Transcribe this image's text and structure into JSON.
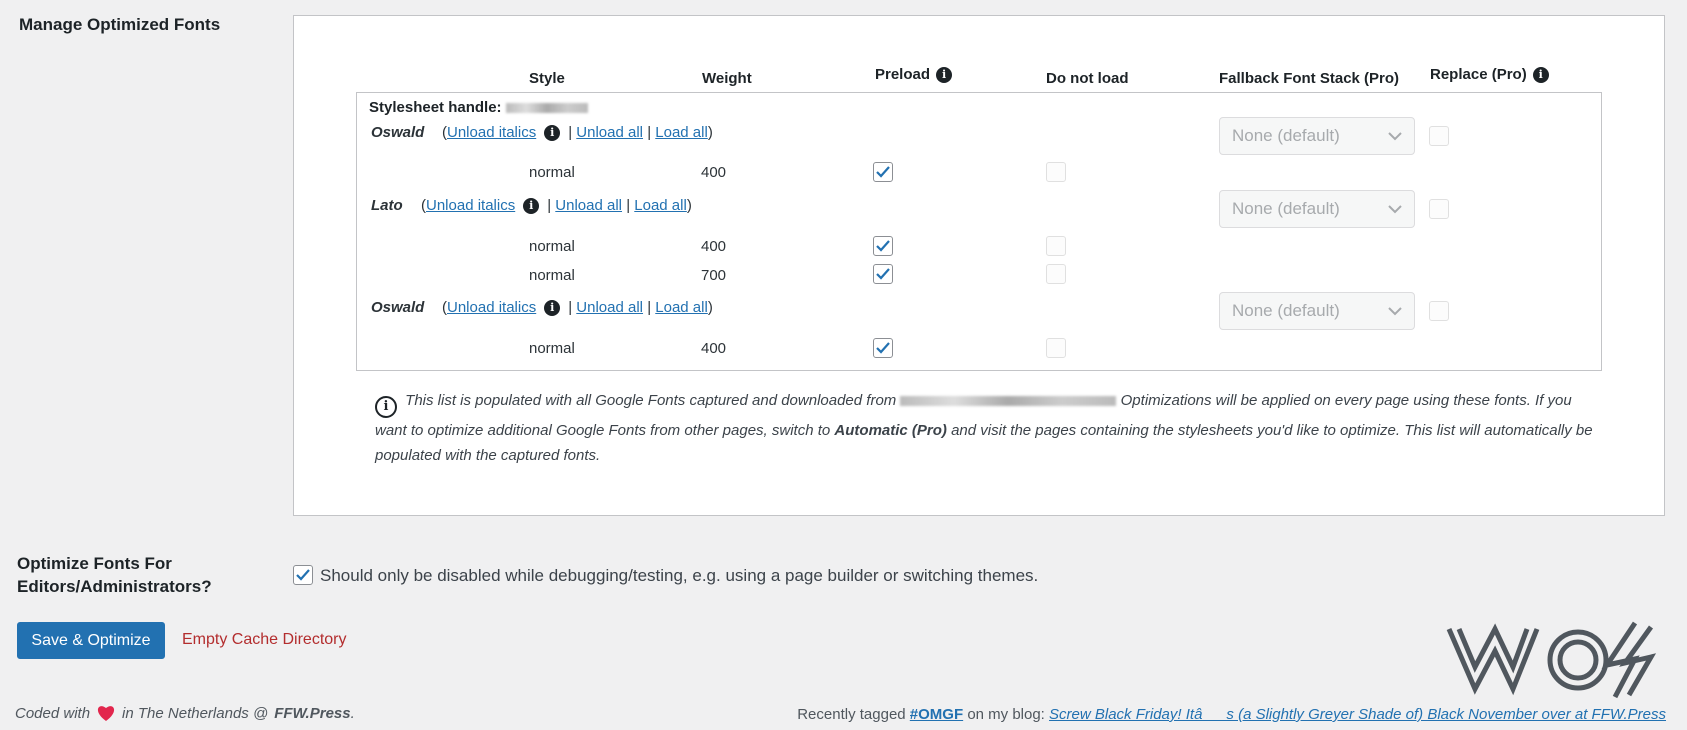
{
  "section_title": "Manage Optimized Fonts",
  "table": {
    "headers": {
      "style": "Style",
      "weight": "Weight",
      "preload": "Preload",
      "do_not_load": "Do not load",
      "fallback": "Fallback Font Stack (Pro)",
      "replace": "Replace (Pro)"
    },
    "stylesheet_handle_label": "Stylesheet handle:",
    "links": {
      "open_paren": "(",
      "unload_italics": "Unload italics",
      "separator": "|",
      "unload_all": "Unload all",
      "load_all": "Load all",
      "close_paren": ")"
    },
    "fallback_placeholder": "None (default)",
    "families": [
      {
        "name": "Oswald",
        "variants": [
          {
            "style": "normal",
            "weight": "400",
            "preload": true,
            "do_not_load": false
          }
        ]
      },
      {
        "name": "Lato",
        "variants": [
          {
            "style": "normal",
            "weight": "400",
            "preload": true,
            "do_not_load": false
          },
          {
            "style": "normal",
            "weight": "700",
            "preload": true,
            "do_not_load": false
          }
        ]
      },
      {
        "name": "Oswald",
        "variants": [
          {
            "style": "normal",
            "weight": "400",
            "preload": true,
            "do_not_load": false
          }
        ]
      }
    ]
  },
  "note": {
    "part1": "This list is populated with all Google Fonts captured and downloaded from",
    "part2": "Optimizations will be applied on every page using these fonts. If you want to optimize additional Google Fonts from other pages, switch to",
    "bold": "Automatic (Pro)",
    "part3": "and visit the pages containing the stylesheets you'd like to optimize. This list will automatically be populated with the captured fonts."
  },
  "optimize_editors": {
    "label": "Optimize Fonts For Editors/Administrators?",
    "description": "Should only be disabled while debugging/testing, e.g. using a page builder or switching themes.",
    "checked": true
  },
  "buttons": {
    "save": "Save & Optimize",
    "empty_cache": "Empty Cache Directory"
  },
  "footer": {
    "coded_with": "Coded with",
    "in_location": "in The Netherlands @",
    "site": "FFW.Press",
    "period": ".",
    "recently_tagged": "Recently tagged",
    "tag": "#OMGF",
    "on_blog": "on my blog:",
    "post_title": "Screw Black Friday! Itâs (a Slightly Greyer Shade of) Black November over at FFW.Press"
  },
  "logo_text": "WOS",
  "colors": {
    "accent": "#2271b1",
    "danger": "#b32d2e",
    "heart": "#e2264d"
  }
}
